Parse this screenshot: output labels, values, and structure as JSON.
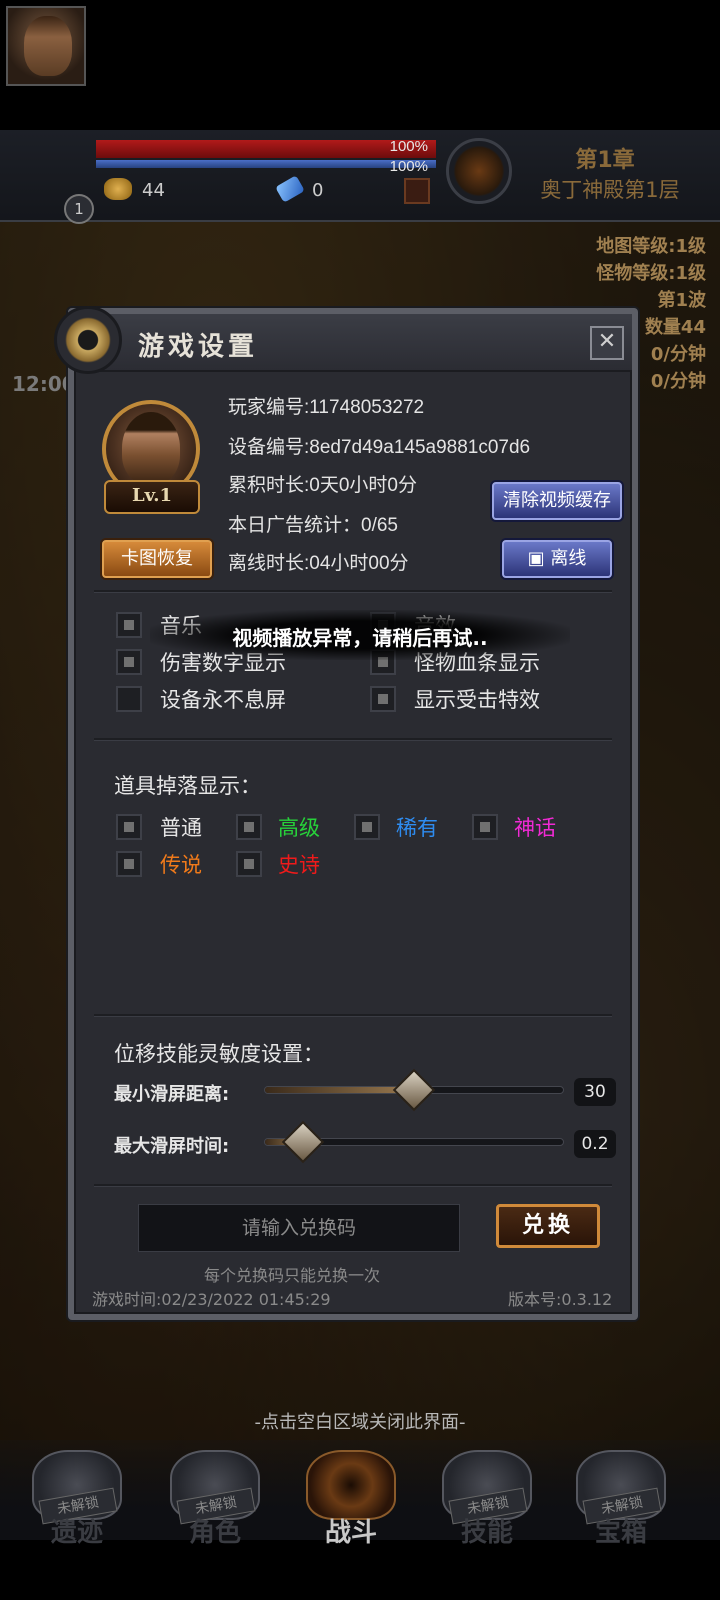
{
  "hud": {
    "hp_pct": "100%",
    "mp_pct": "100%",
    "gold": "44",
    "gems": "0",
    "level": "1",
    "chapter": "第1章",
    "floor": "奥丁神殿第1层"
  },
  "side_stats": {
    "map_level": "地图等级:1级",
    "monster_level": "怪物等级:1级",
    "wave": "第1波",
    "count": "数量44",
    "rate1": "0/分钟",
    "rate2": "0/分钟",
    "clock": "12:00"
  },
  "dialog": {
    "title": "游戏设置",
    "close_icon": "✕",
    "level_badge": "Lv.1",
    "player_id": "玩家编号:11748053272",
    "device_id": "设备编号:8ed7d49a145a9881c07d6",
    "total_time": "累积时长:0天0小时0分",
    "ad_stats": "本日广告统计：0/65",
    "offline_time": "离线时长:04小时00分",
    "restore_button": "卡图恢复",
    "clear_cache_button": "清除视频缓存",
    "offline_button": "离线",
    "options": [
      {
        "label": "音乐",
        "checked": true
      },
      {
        "label": "音效",
        "checked": true
      },
      {
        "label": "伤害数字显示",
        "checked": true
      },
      {
        "label": "怪物血条显示",
        "checked": true
      },
      {
        "label": "设备永不息屏",
        "checked": false
      },
      {
        "label": "显示受击特效",
        "checked": true
      }
    ],
    "drop_title": "道具掉落显示：",
    "drops": [
      {
        "label": "普通",
        "color": "#e6e6e6",
        "checked": true
      },
      {
        "label": "高级",
        "color": "#27d23a",
        "checked": true
      },
      {
        "label": "稀有",
        "color": "#2e8cf0",
        "checked": true
      },
      {
        "label": "神话",
        "color": "#f02ad4",
        "checked": true
      },
      {
        "label": "传说",
        "color": "#f07a1a",
        "checked": true
      },
      {
        "label": "史诗",
        "color": "#f01a1a",
        "checked": true
      }
    ],
    "sensitivity_title": "位移技能灵敏度设置：",
    "min_distance_label": "最小滑屏距离:",
    "min_distance_value": "30",
    "min_distance_fraction": 0.5,
    "max_time_label": "最大滑屏时间:",
    "max_time_value": "0.2",
    "max_time_fraction": 0.13,
    "code_placeholder": "请输入兑换码",
    "redeem_button": "兑换",
    "redeem_note": "每个兑换码只能兑换一次",
    "game_time": "游戏时间:02/23/2022 01:45:29",
    "version": "版本号:0.3.12"
  },
  "toast": "视频播放异常，请稍后再试..",
  "close_hint": "-点击空白区域关闭此界面-",
  "tabs": [
    {
      "name": "遗迹",
      "lock": "未解锁",
      "active": false
    },
    {
      "name": "角色",
      "lock": "未解锁",
      "active": false
    },
    {
      "name": "战斗",
      "lock": "",
      "active": true
    },
    {
      "name": "技能",
      "lock": "未解锁",
      "active": false
    },
    {
      "name": "宝箱",
      "lock": "未解锁",
      "active": false
    }
  ]
}
